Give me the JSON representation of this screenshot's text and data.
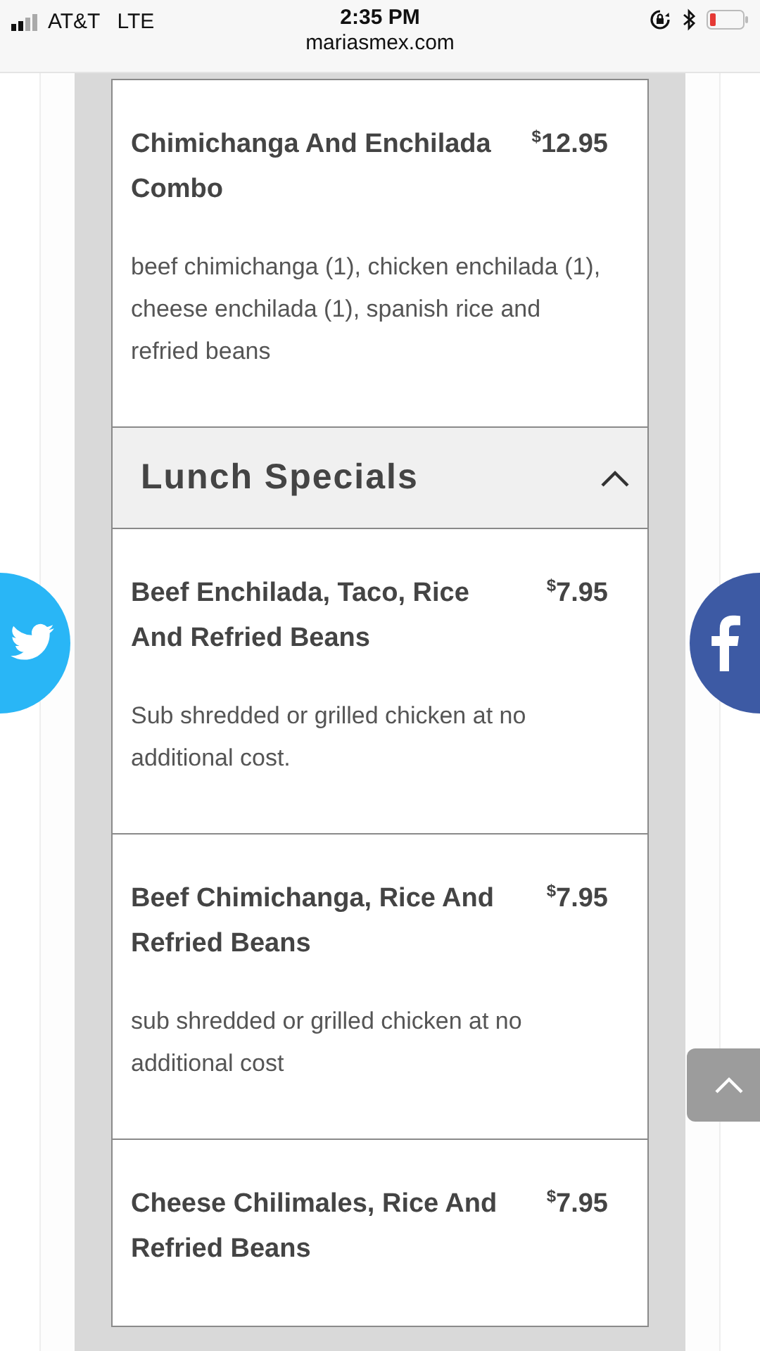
{
  "status_bar": {
    "carrier": "AT&T",
    "network": "LTE",
    "time": "2:35 PM",
    "url": "mariasmex.com"
  },
  "sections": [
    {
      "kind": "items",
      "items": [
        {
          "name": "Chimichanga And Enchilada Combo",
          "currency": "$",
          "price": "12.95",
          "description": "beef chimichanga (1), chicken enchilada (1), cheese enchilada (1), spanish rice and refried beans"
        }
      ]
    },
    {
      "kind": "header",
      "title": "Lunch Specials",
      "expanded": true
    },
    {
      "kind": "items",
      "items": [
        {
          "name": "Beef Enchilada, Taco, Rice And Refried Beans",
          "currency": "$",
          "price": "7.95",
          "description": "Sub shredded or grilled chicken at no additional cost."
        },
        {
          "name": "Beef Chimichanga, Rice And Refried Beans",
          "currency": "$",
          "price": "7.95",
          "description": "sub shredded or grilled chicken at no additional cost"
        },
        {
          "name": "Cheese Chilimales, Rice And Refried Beans",
          "currency": "$",
          "price": "7.95"
        }
      ]
    }
  ]
}
